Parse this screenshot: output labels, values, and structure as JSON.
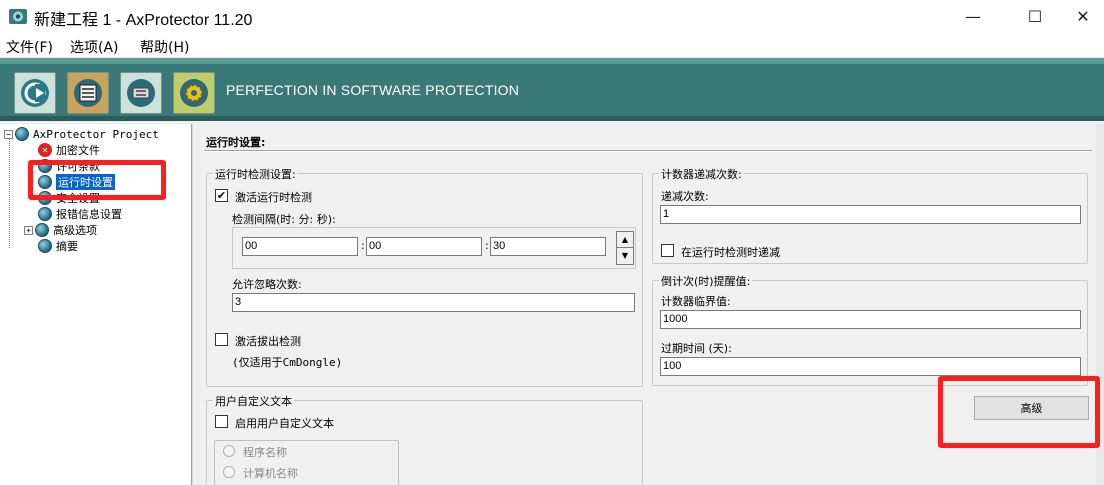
{
  "window": {
    "title": "新建工程 1 - AxProtector 11.20",
    "minimize_glyph": "—",
    "maximize_glyph": "☐",
    "close_glyph": "✕"
  },
  "menu": {
    "file": "文件(F)",
    "options": "选项(A)",
    "help": "帮助(H)"
  },
  "banner": {
    "tagline": "PERFECTION IN SOFTWARE PROTECTION",
    "toolbar_icons": [
      "new-project-icon",
      "open-project-icon",
      "save-project-icon",
      "run-wizard-icon"
    ],
    "color": "#3b7878"
  },
  "tree": {
    "root": "AxProtector Project",
    "items": [
      {
        "label": "加密文件",
        "icon": "error-icon"
      },
      {
        "label": "许可条款",
        "icon": "globe-icon"
      },
      {
        "label": "运行时设置",
        "icon": "globe-icon",
        "selected": true
      },
      {
        "label": "安全设置",
        "icon": "globe-icon"
      },
      {
        "label": "报错信息设置",
        "icon": "globe-icon"
      },
      {
        "label": "高级选项",
        "icon": "globe-icon",
        "expandable": true
      },
      {
        "label": "摘要",
        "icon": "globe-icon"
      }
    ],
    "expand_glyph": "−",
    "collapse_glyph": "+"
  },
  "content": {
    "section_title": "运行时设置:",
    "runtime_check": {
      "group_label": "运行时检测设置:",
      "enable_label": "激活运行时检测",
      "enable_checked": true,
      "interval_label": "检测间隔(时: 分: 秒):",
      "hours": "00",
      "minutes": "00",
      "seconds": "30",
      "colon": ":",
      "spin_up": "▲",
      "spin_down": "▼",
      "ignore_label": "允许忽略次数:",
      "ignore_value": "3",
      "unplug_label": "激活拔出检测",
      "unplug_checked": false,
      "unplug_note": "(仅适用于CmDongle)"
    },
    "counter": {
      "group_label": "计数器递减次数:",
      "decrement_label": "递减次数:",
      "decrement_value": "1",
      "decrement_on_check_label": "在运行时检测时递减",
      "decrement_on_check_checked": false
    },
    "reminder": {
      "group_label": "倒计次(时)提醒值:",
      "threshold_label": "计数器临界值:",
      "threshold_value": "1000",
      "expiry_label": "过期时间 (天):",
      "expiry_value": "100"
    },
    "advanced_button": "高级",
    "custom_text": {
      "group_label": "用户自定义文本",
      "enable_label": "启用用户自定义文本",
      "enable_checked": false,
      "options": [
        "程序名称",
        "计算机名称"
      ]
    },
    "check_glyph": "✔"
  },
  "highlight_color": "#ff1e1e"
}
